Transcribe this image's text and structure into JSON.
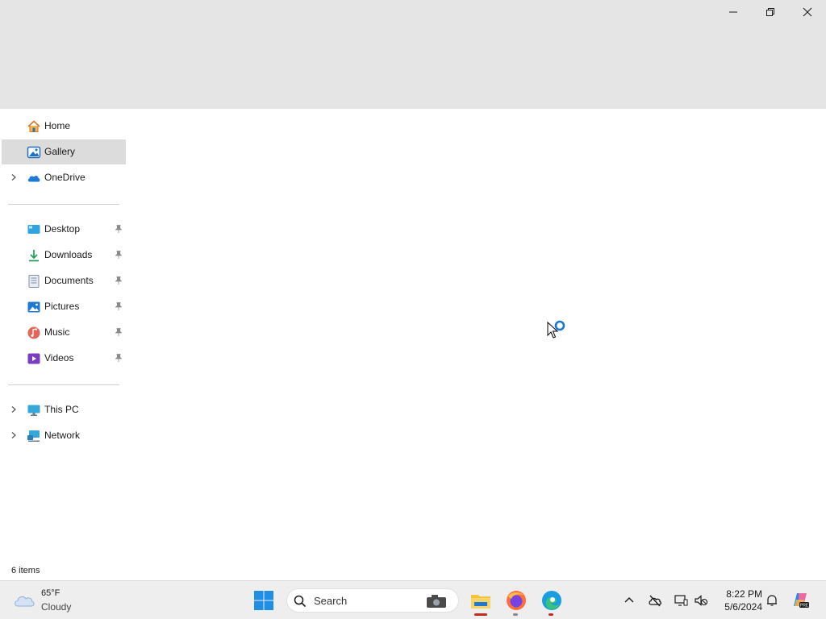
{
  "window": {
    "minimize_icon": "minimize-icon",
    "restore_icon": "restore-icon",
    "close_icon": "close-icon"
  },
  "nav": {
    "items": [
      {
        "label": "Home",
        "icon": "home-icon",
        "selected": false,
        "expandable": false
      },
      {
        "label": "Gallery",
        "icon": "gallery-icon",
        "selected": true,
        "expandable": false
      },
      {
        "label": "OneDrive",
        "icon": "onedrive-icon",
        "selected": false,
        "expandable": true
      }
    ],
    "quick_access": [
      {
        "label": "Desktop",
        "icon": "desktop-icon",
        "pinned": true
      },
      {
        "label": "Downloads",
        "icon": "downloads-icon",
        "pinned": true
      },
      {
        "label": "Documents",
        "icon": "documents-icon",
        "pinned": true
      },
      {
        "label": "Pictures",
        "icon": "pictures-icon",
        "pinned": true
      },
      {
        "label": "Music",
        "icon": "music-icon",
        "pinned": true
      },
      {
        "label": "Videos",
        "icon": "videos-icon",
        "pinned": true
      }
    ],
    "devices": [
      {
        "label": "This PC",
        "icon": "this-pc-icon",
        "expandable": true
      },
      {
        "label": "Network",
        "icon": "network-icon",
        "expandable": true
      }
    ]
  },
  "status_bar": {
    "item_count": "6 items"
  },
  "taskbar": {
    "weather": {
      "temp": "65°F",
      "condition": "Cloudy",
      "icon": "cloud-icon"
    },
    "search": {
      "label": "Search"
    },
    "apps": [
      {
        "name": "file-explorer-icon",
        "active": true
      },
      {
        "name": "firefox-icon",
        "active": false
      },
      {
        "name": "edge-icon",
        "active": false
      }
    ],
    "clock": {
      "time": "8:22 PM",
      "date": "5/6/2024"
    }
  },
  "colors": {
    "titlebar_bg": "#e5e5e5",
    "selected_bg": "#dcdcdc",
    "taskbar_bg": "#eeeeee",
    "accent_blue": "#0067c0",
    "indicator_red": "#c42b1c"
  }
}
